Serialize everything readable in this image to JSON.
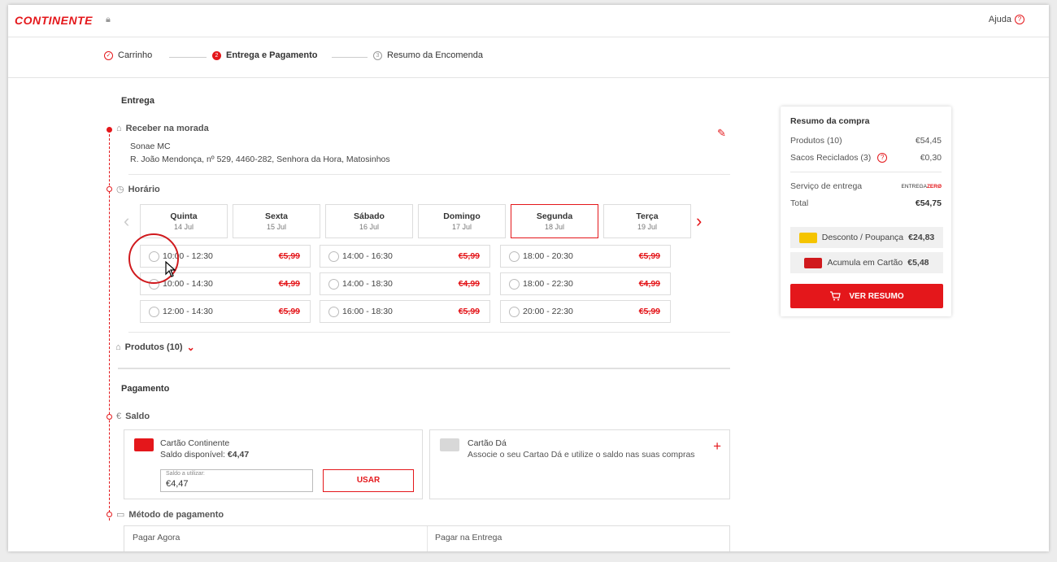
{
  "header": {
    "logo": "CONTINENTE",
    "help": "Ajuda"
  },
  "steps": [
    {
      "label": "Carrinho",
      "num": "✓",
      "state": "done"
    },
    {
      "label": "Entrega e Pagamento",
      "num": "2",
      "state": "active"
    },
    {
      "label": "Resumo da Encomenda",
      "num": "3",
      "state": "todo"
    }
  ],
  "delivery": {
    "title": "Entrega",
    "method": "Receber na morada",
    "name": "Sonae MC",
    "address": "R. João Mendonça, nº 529, 4460-282, Senhora da Hora, Matosinhos",
    "schedule_title": "Horário",
    "days": [
      {
        "name": "Quinta",
        "date": "14 Jul"
      },
      {
        "name": "Sexta",
        "date": "15 Jul"
      },
      {
        "name": "Sábado",
        "date": "16 Jul"
      },
      {
        "name": "Domingo",
        "date": "17 Jul"
      },
      {
        "name": "Segunda",
        "date": "18 Jul"
      },
      {
        "name": "Terça",
        "date": "19 Jul"
      }
    ],
    "selected_day": "Segunda",
    "slots": [
      [
        {
          "time": "10:00 - 12:30",
          "price": "€5,99"
        },
        {
          "time": "14:00 - 16:30",
          "price": "€5,99"
        },
        {
          "time": "18:00 - 20:30",
          "price": "€5,99"
        }
      ],
      [
        {
          "time": "10:00 - 14:30",
          "price": "€4,99"
        },
        {
          "time": "14:00 - 18:30",
          "price": "€4,99"
        },
        {
          "time": "18:00 - 22:30",
          "price": "€4,99"
        }
      ],
      [
        {
          "time": "12:00 - 14:30",
          "price": "€5,99"
        },
        {
          "time": "16:00 - 18:30",
          "price": "€5,99"
        },
        {
          "time": "20:00 - 22:30",
          "price": "€5,99"
        }
      ]
    ],
    "products": "Produtos (10)"
  },
  "payment": {
    "title": "Pagamento",
    "balance_title": "Saldo",
    "continente_card": {
      "title": "Cartão Continente",
      "balance_label": "Saldo disponível:",
      "balance": "€4,47",
      "field_label": "Saldo a utilizar:",
      "field_value": "€4,47",
      "button": "USAR"
    },
    "da_card": {
      "title": "Cartão Dá",
      "desc": "Associe o seu Cartao Dá e utilize o saldo nas suas compras"
    },
    "method_title": "Método de pagamento",
    "tabs": [
      "Pagar Agora",
      "Pagar na Entrega"
    ]
  },
  "summary": {
    "title": "Resumo da compra",
    "products_label": "Produtos (10)",
    "products_value": "€54,45",
    "bags_label": "Sacos Reciclados (3)",
    "bags_value": "€0,30",
    "delivery_label": "Serviço de entrega",
    "delivery_badge_1": "ENTREGA",
    "delivery_badge_2": "ZERØ",
    "total_label": "Total",
    "total_value": "€54,75",
    "discount_label": "Desconto / Poupança",
    "discount_value": "€24,83",
    "card_label": "Acumula em Cartão",
    "card_value": "€5,48",
    "button": "VER RESUMO"
  },
  "colors": {
    "brand": "#e4171b"
  }
}
